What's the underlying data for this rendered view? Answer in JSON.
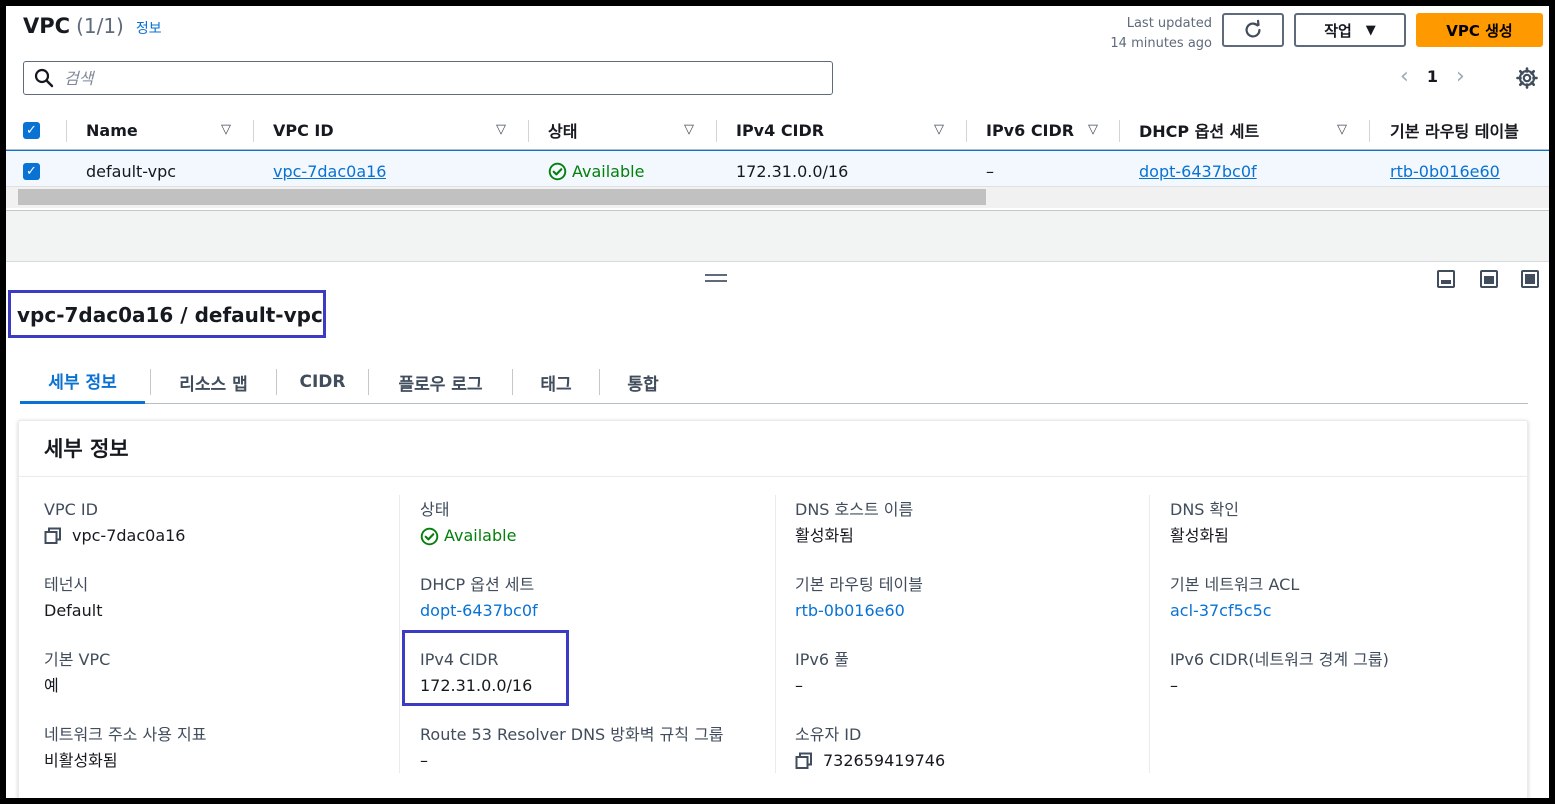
{
  "header": {
    "title": "VPC",
    "count": "(1/1)",
    "info": "정보",
    "last_updated_line1": "Last updated",
    "last_updated_line2": "14 minutes ago",
    "actions_label": "작업",
    "create_label": "VPC 생성"
  },
  "search": {
    "placeholder": "검색"
  },
  "pagination": {
    "current_page": "1"
  },
  "table": {
    "columns": [
      "Name",
      "VPC ID",
      "상태",
      "IPv4 CIDR",
      "IPv6 CIDR",
      "DHCP 옵션 세트",
      "기본 라우팅 테이블"
    ],
    "rows": [
      {
        "name": "default-vpc",
        "vpc_id": "vpc-7dac0a16",
        "status": "Available",
        "ipv4_cidr": "172.31.0.0/16",
        "ipv6_cidr": "–",
        "dhcp": "dopt-6437bc0f",
        "route_table": "rtb-0b016e60"
      }
    ]
  },
  "detail": {
    "title": "vpc-7dac0a16 / default-vpc",
    "tabs": [
      "세부 정보",
      "리소스 맵",
      "CIDR",
      "플로우 로그",
      "태그",
      "통합"
    ],
    "section_title": "세부 정보",
    "fields": {
      "vpc_id": {
        "label": "VPC ID",
        "value": "vpc-7dac0a16"
      },
      "tenancy": {
        "label": "테넌시",
        "value": "Default"
      },
      "default_vpc": {
        "label": "기본 VPC",
        "value": "예"
      },
      "network_usage": {
        "label": "네트워크 주소 사용 지표",
        "value": "비활성화됨"
      },
      "state": {
        "label": "상태",
        "value": "Available"
      },
      "dhcp": {
        "label": "DHCP 옵션 세트",
        "value": "dopt-6437bc0f"
      },
      "ipv4": {
        "label": "IPv4 CIDR",
        "value": "172.31.0.0/16"
      },
      "route53": {
        "label": "Route 53 Resolver DNS 방화벽 규칙 그룹",
        "value": "–"
      },
      "dns_hostnames": {
        "label": "DNS 호스트 이름",
        "value": "활성화됨"
      },
      "main_route": {
        "label": "기본 라우팅 테이블",
        "value": "rtb-0b016e60"
      },
      "ipv6_pool": {
        "label": "IPv6 풀",
        "value": "–"
      },
      "owner": {
        "label": "소유자 ID",
        "value": "732659419746"
      },
      "dns_resolution": {
        "label": "DNS 확인",
        "value": "활성화됨"
      },
      "main_acl": {
        "label": "기본 네트워크 ACL",
        "value": "acl-37cf5c5c"
      },
      "ipv6_cidr": {
        "label": "IPv6 CIDR(네트워크 경계 그룹)",
        "value": "–"
      }
    }
  },
  "colors": {
    "link": "#0972d3",
    "success": "#037f0c",
    "primary_button": "#ff9900",
    "annotation": "#3b3bc4"
  },
  "icons": [
    "search-icon",
    "refresh-icon",
    "caret-down-icon",
    "chevron-left-icon",
    "chevron-right-icon",
    "gear-icon",
    "check-circle-icon",
    "copy-icon",
    "drag-handle-icon",
    "panel-bottom-icon",
    "panel-side-icon",
    "panel-full-icon"
  ]
}
